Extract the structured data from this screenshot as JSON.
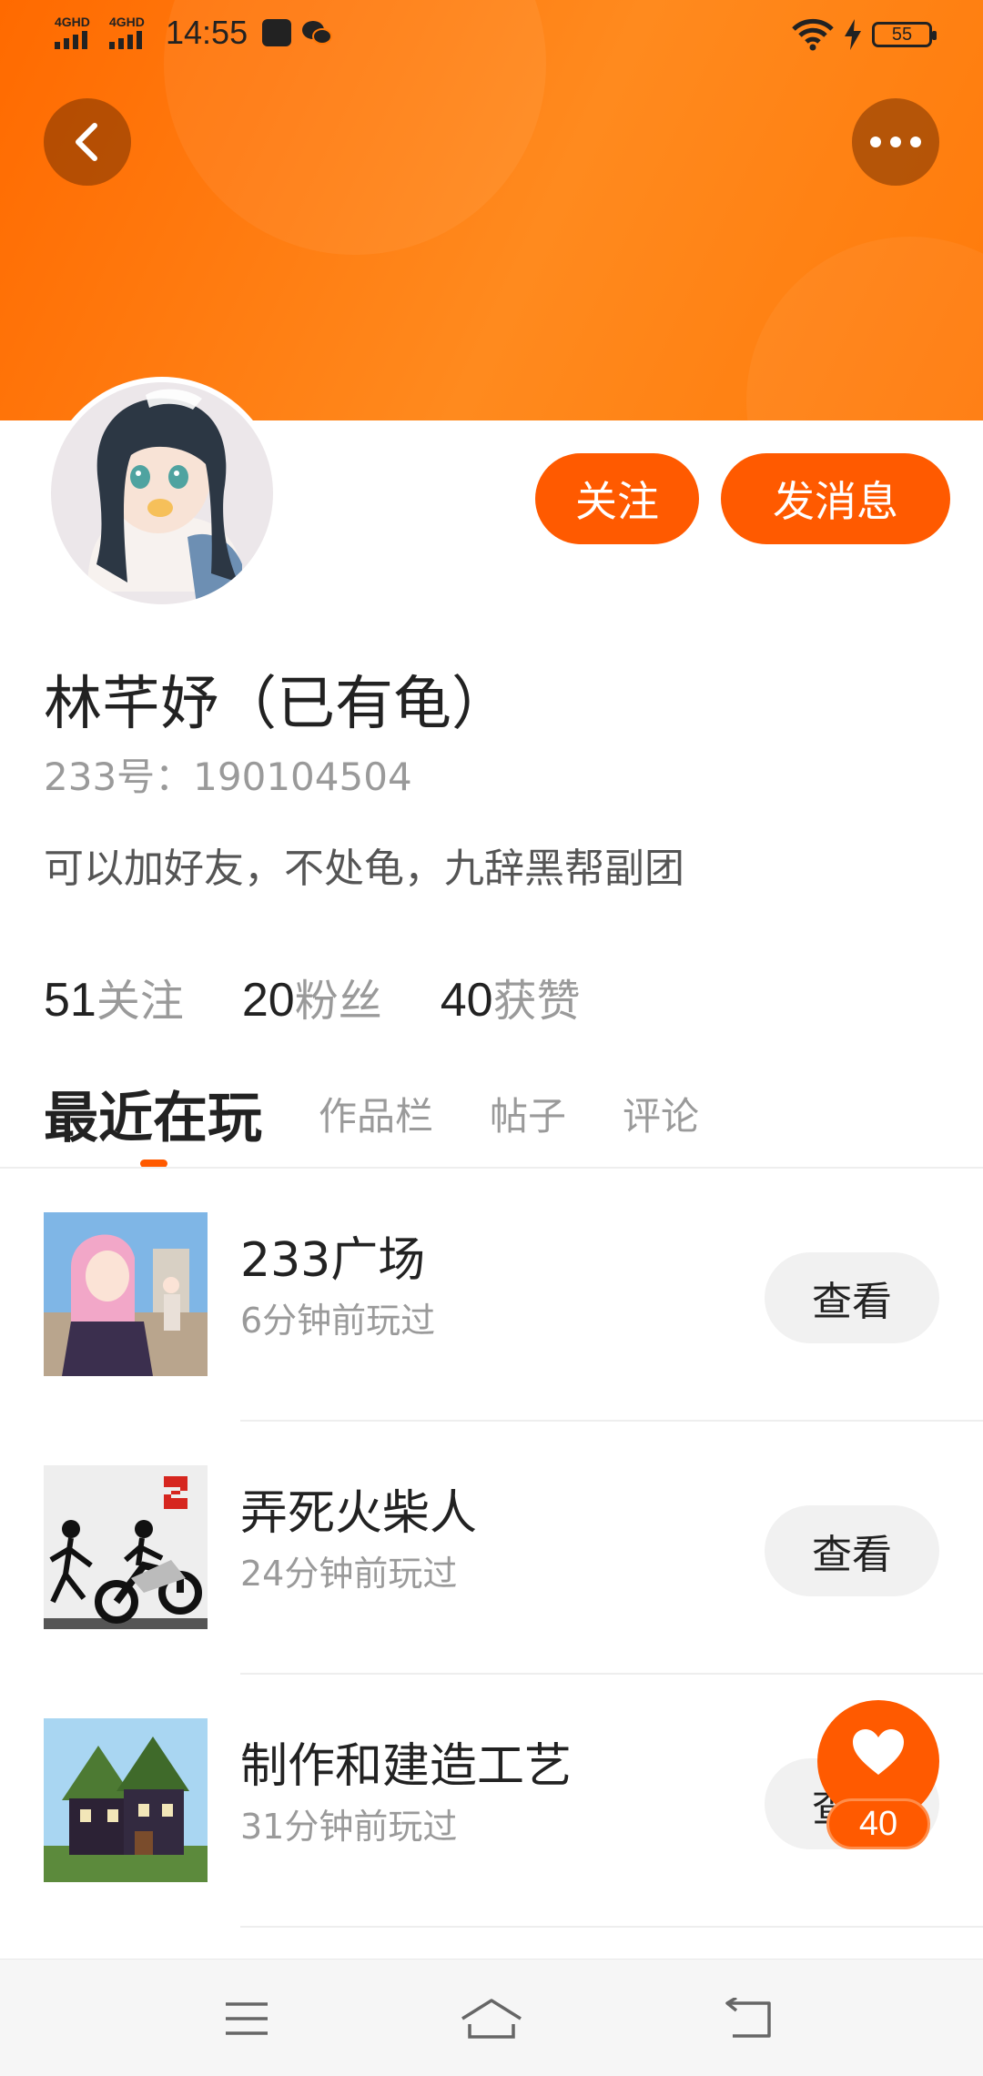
{
  "status_bar": {
    "signal1": "4GHD",
    "signal2": "4GHD",
    "time": "14:55",
    "battery": "55"
  },
  "header": {
    "back_icon": "chevron-left-icon",
    "more_icon": "more-dots-icon",
    "gradient_color": "#ff7a0a"
  },
  "profile": {
    "follow_label": "关注",
    "message_label": "发消息",
    "name": "林芊妤（已有龟）",
    "id_text": "233号：190104504",
    "bio": "可以加好友，不处龟，九辞黑帮副团",
    "stats": [
      {
        "num": "51",
        "label": "关注"
      },
      {
        "num": "20",
        "label": "粉丝"
      },
      {
        "num": "40",
        "label": "获赞"
      }
    ]
  },
  "tabs": [
    {
      "label": "最近在玩",
      "active": true
    },
    {
      "label": "作品栏",
      "active": false
    },
    {
      "label": "帖子",
      "active": false
    },
    {
      "label": "评论",
      "active": false
    }
  ],
  "games": [
    {
      "title": "233广场",
      "subtitle": "6分钟前玩过",
      "action": "查看"
    },
    {
      "title": "弄死火柴人",
      "subtitle": "24分钟前玩过",
      "action": "查看"
    },
    {
      "title": "制作和建造工艺",
      "subtitle": "31分钟前玩过",
      "action": "查看"
    }
  ],
  "like_fab": {
    "icon": "heart-icon",
    "count": "40"
  },
  "accent_color": "#ff5a00",
  "navbar": [
    "menu-icon",
    "home-icon",
    "back-icon"
  ]
}
